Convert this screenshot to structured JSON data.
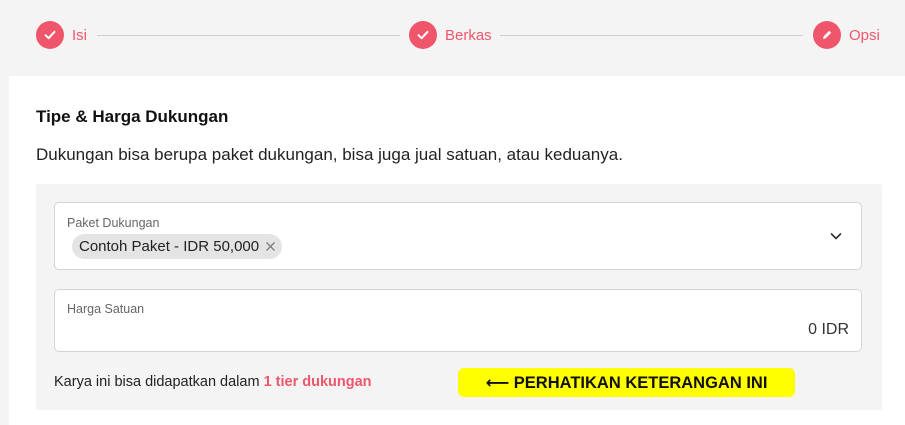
{
  "stepper": {
    "steps": [
      {
        "label": "Isi",
        "icon": "check-icon"
      },
      {
        "label": "Berkas",
        "icon": "check-icon"
      },
      {
        "label": "Opsi",
        "icon": "pencil-icon"
      }
    ],
    "accent": "#f0566b"
  },
  "section": {
    "title": "Tipe & Harga Dukungan",
    "description": "Dukungan bisa berupa paket dukungan, bisa juga jual satuan, atau keduanya."
  },
  "packages_field": {
    "label": "Paket Dukungan",
    "selected": [
      "Contoh Paket - IDR 50,000"
    ]
  },
  "price_field": {
    "label": "Harga Satuan",
    "value": "0 IDR"
  },
  "tier_info": {
    "prefix": "Karya ini bisa didapatkan dalam ",
    "link": "1 tier dukungan"
  },
  "annotation": {
    "text": "⟵ PERHATIKAN KETERANGAN INI",
    "color": "#ffff00"
  }
}
